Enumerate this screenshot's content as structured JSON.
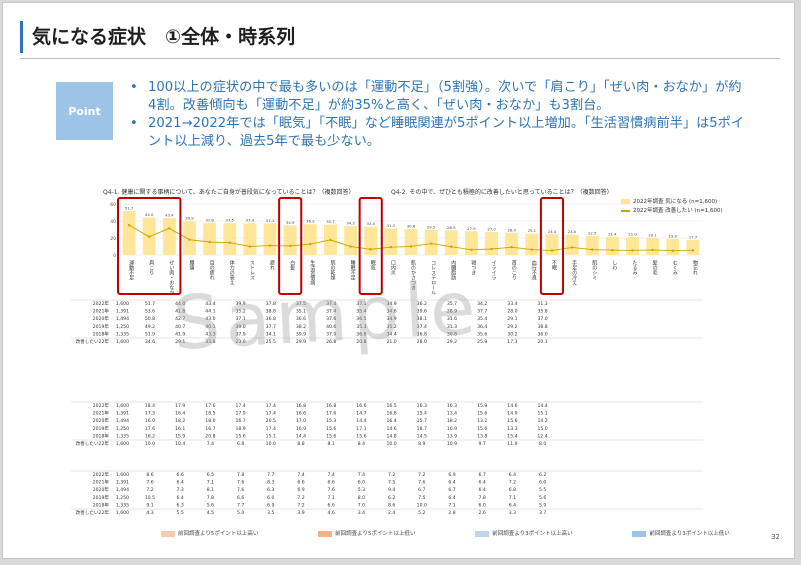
{
  "slide": {
    "title": "気になる症状　①全体・時系列",
    "point_label": "Point",
    "bullets": [
      "100以上の症状の中で最も多いのは「運動不足」（5割強）。次いで「肩こり」「ぜい肉・おなか」が約4割。改善傾向も「運動不足」が約35%と高く、「ぜい肉・おなか」も3割台。",
      "2021→2022年では「眠気」「不眠」など睡眠関連が5ポイント以上増加。「生活習慣病前半」は5ポイント以上減り、過去5年で最も少ない。"
    ],
    "q_left": "Q4-1. 健康に関する事柄について、あなたご自身が普段気になっていることは？（複数回答）",
    "q_right": "Q4-2. その中で、ぜひとも積極的に改善したいと思っていることは？（複数回答）",
    "legend": {
      "bar": "2022年調査 気になる (n=1,600)",
      "line": "2022年調査 改善したい (n=1,600)"
    },
    "watermark": "Sample",
    "page_number": "32",
    "footer_legend": [
      "前回調査より5ポイント以上高い",
      "前回調査より5ポイント以上低い",
      "前回調査より3ポイント以上高い",
      "前回調査より3ポイント以上低い"
    ],
    "colors": {
      "accent": "#2e75b6",
      "point_box": "#9dc3e6",
      "bar": "#ffe699",
      "line": "#c9a600",
      "highlight_box": "#c00000",
      "up": "#f8cbad",
      "down": "#bdd7ee"
    }
  },
  "chart_data": {
    "type": "bar",
    "ylim": [
      0,
      60
    ],
    "yticks": [
      0,
      20,
      40,
      60
    ],
    "categories": [
      "運動不足",
      "肩こり",
      "ぜい肉・おなか",
      "腰痛",
      "目の疲れ",
      "体力の衰え",
      "ストレス",
      "疲れ",
      "白髪",
      "生活習慣病",
      "肌の乾燥",
      "睡眠不足",
      "眠気",
      "口内炎",
      "肌のかさつき",
      "コレステロール",
      "内臓脂肪",
      "寝つき",
      "イライラ",
      "首のこり",
      "血行不良",
      "不眠",
      "手足の冷え",
      "肌のシミ",
      "しわ",
      "たるみ",
      "髪の毛",
      "むくみ",
      "物忘れ"
    ],
    "series": [
      {
        "name": "2022年調査 気になる (n=1,600)",
        "values": [
          51.7,
          44.0,
          43.4,
          39.9,
          37.8,
          37.5,
          37.4,
          37.1,
          34.9,
          36.2,
          35.7,
          34.2,
          33.4,
          31.3,
          30.6,
          29.5,
          28.9,
          27.9,
          27.0,
          26.0,
          25.1,
          24.4,
          24.0,
          22.5,
          21.4,
          21.0,
          20.1,
          19.0,
          17.7
        ]
      },
      {
        "name": "2022年調査 改善したい (n=1,600)",
        "values": [
          35.1,
          21.5,
          31.4,
          18.0,
          15.3,
          14.5,
          10.0,
          11.1,
          10.7,
          12.8,
          17.8,
          10.0,
          6.7,
          9.2,
          10.1,
          13.4,
          9.8,
          6.1,
          7.1,
          9.2,
          6.4,
          5.2,
          8.9,
          6.4,
          5.6,
          5.4,
          6.0,
          5.1,
          5.6
        ]
      }
    ],
    "tables": [
      {
        "rows": [
          {
            "year": "2022年",
            "n": "1,600",
            "values": [
              "51.7",
              "44.0",
              "43.4",
              "39.9",
              "37.8",
              "37.5",
              "37.4",
              "37.1",
              "34.9",
              "36.2",
              "35.7",
              "34.2",
              "33.4",
              "31.3"
            ]
          },
          {
            "year": "2021年",
            "n": "1,391",
            "values": [
              "53.6",
              "41.8",
              "44.1",
              "35.2",
              "38.8",
              "35.1",
              "37.4",
              "35.4",
              "34.6",
              "39.6",
              "28.9",
              "37.7",
              "28.0",
              "35.8"
            ]
          },
          {
            "year": "2020年",
            "n": "1,494",
            "values": [
              "50.8",
              "42.7",
              "43.0",
              "37.1",
              "36.8",
              "36.6",
              "37.6",
              "36.5",
              "34.9",
              "38.1",
              "31.6",
              "35.4",
              "29.1",
              "37.0"
            ]
          },
          {
            "year": "2019年",
            "n": "1,250",
            "values": [
              "49.2",
              "40.7",
              "40.1",
              "39.0",
              "37.7",
              "38.2",
              "40.6",
              "35.3",
              "35.2",
              "37.4",
              "31.3",
              "36.4",
              "29.2",
              "38.8"
            ]
          },
          {
            "year": "2018年",
            "n": "1,335",
            "values": [
              "51.9",
              "41.9",
              "43.3",
              "37.9",
              "34.1",
              "39.9",
              "37.9",
              "36.6",
              "34.4",
              "36.8",
              "30.8",
              "35.6",
              "30.2",
              "36.0"
            ]
          },
          {
            "year": "改善したい22年",
            "n": "1,600",
            "values": [
              "34.6",
              "29.1",
              "33.8",
              "23.0",
              "25.5",
              "29.9",
              "26.8",
              "20.8",
              "21.0",
              "28.0",
              "29.2",
              "25.9",
              "17.3",
              "20.1"
            ]
          }
        ]
      },
      {
        "rows": [
          {
            "year": "2022年",
            "n": "1,600",
            "values": [
              "18.4",
              "17.9",
              "17.6",
              "17.4",
              "17.4",
              "16.8",
              "16.8",
              "16.6",
              "16.5",
              "16.3",
              "16.3",
              "15.9",
              "14.6",
              "14.4"
            ]
          },
          {
            "year": "2021年",
            "n": "1,391",
            "values": [
              "17.3",
              "16.4",
              "18.5",
              "17.9",
              "17.4",
              "16.6",
              "17.6",
              "14.7",
              "16.8",
              "15.4",
              "13.4",
              "15.6",
              "14.9",
              "15.1"
            ]
          },
          {
            "year": "2020年",
            "n": "1,494",
            "values": [
              "16.0",
              "18.2",
              "18.0",
              "16.7",
              "20.5",
              "17.0",
              "15.3",
              "14.4",
              "16.4",
              "15.7",
              "18.2",
              "13.2",
              "15.6",
              "14.2"
            ]
          },
          {
            "year": "2019年",
            "n": "1,250",
            "values": [
              "17.6",
              "16.1",
              "16.7",
              "18.9",
              "17.4",
              "16.9",
              "15.6",
              "17.1",
              "14.6",
              "18.7",
              "16.9",
              "15.6",
              "13.3",
              "15.0"
            ]
          },
          {
            "year": "2018年",
            "n": "1,335",
            "values": [
              "16.2",
              "15.9",
              "20.8",
              "15.6",
              "15.1",
              "14.4",
              "15.6",
              "15.6",
              "14.8",
              "14.5",
              "13.9",
              "13.8",
              "15.4",
              "12.4"
            ]
          },
          {
            "year": "改善したい22年",
            "n": "1,600",
            "values": [
              "10.0",
              "10.4",
              "7.4",
              "6.8",
              "10.0",
              "8.8",
              "8.1",
              "8.4",
              "10.0",
              "8.9",
              "10.9",
              "9.7",
              "11.9",
              "8.0"
            ]
          }
        ]
      },
      {
        "rows": [
          {
            "year": "2022年",
            "n": "1,600",
            "values": [
              "8.6",
              "6.6",
              "6.5",
              "7.8",
              "7.7",
              "7.4",
              "7.4",
              "7.4",
              "7.2",
              "7.2",
              "6.9",
              "6.7",
              "6.4",
              "6.2"
            ]
          },
          {
            "year": "2021年",
            "n": "1,391",
            "values": [
              "7.6",
              "6.4",
              "7.1",
              "7.6",
              "8.3",
              "6.6",
              "6.6",
              "6.0",
              "7.5",
              "7.6",
              "6.4",
              "6.4",
              "7.2",
              "6.0"
            ]
          },
          {
            "year": "2020年",
            "n": "1,494",
            "values": [
              "7.2",
              "7.3",
              "8.1",
              "7.6",
              "6.3",
              "6.9",
              "7.6",
              "5.3",
              "9.4",
              "6.7",
              "6.7",
              "6.4",
              "6.8",
              "5.5"
            ]
          },
          {
            "year": "2019年",
            "n": "1,250",
            "values": [
              "10.5",
              "6.4",
              "7.8",
              "6.6",
              "6.0",
              "7.2",
              "7.1",
              "8.0",
              "6.2",
              "7.5",
              "6.4",
              "7.8",
              "7.1",
              "5.6"
            ]
          },
          {
            "year": "2018年",
            "n": "1,335",
            "values": [
              "9.1",
              "6.3",
              "5.6",
              "7.7",
              "6.9",
              "7.2",
              "6.6",
              "7.0",
              "8.6",
              "10.0",
              "7.1",
              "6.0",
              "6.4",
              "5.9"
            ]
          },
          {
            "year": "改善したい22年",
            "n": "1,600",
            "values": [
              "4.3",
              "5.5",
              "4.5",
              "5.0",
              "3.5",
              "3.9",
              "4.6",
              "3.4",
              "2.4",
              "5.2",
              "2.8",
              "2.6",
              "3.3",
              "3.7"
            ]
          }
        ]
      }
    ]
  }
}
